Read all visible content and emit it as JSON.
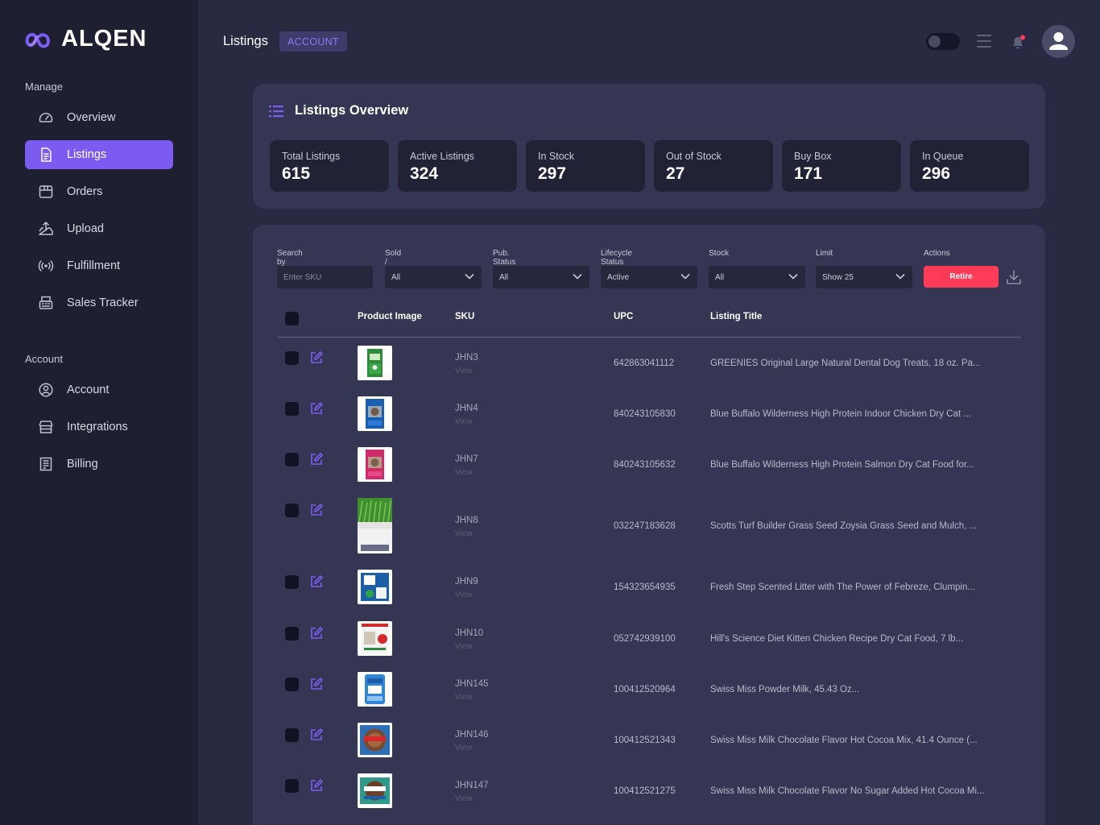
{
  "brand": {
    "name": "ALQEN",
    "logo_icon": "infinity-logo-icon",
    "accent": "#7b5bf0"
  },
  "sidebar": {
    "manage_label": "Manage",
    "manage_items": [
      {
        "label": "Overview",
        "icon": "gauge-icon"
      },
      {
        "label": "Listings",
        "icon": "document-icon",
        "active": true
      },
      {
        "label": "Orders",
        "icon": "box-icon"
      },
      {
        "label": "Upload",
        "icon": "upload-icon"
      },
      {
        "label": "Fulfillment",
        "icon": "broadcast-icon"
      },
      {
        "label": "Sales Tracker",
        "icon": "register-icon"
      }
    ],
    "account_label": "Account",
    "account_items": [
      {
        "label": "Account",
        "icon": "user-circle-icon"
      },
      {
        "label": "Integrations",
        "icon": "store-icon"
      },
      {
        "label": "Billing",
        "icon": "receipt-icon"
      }
    ]
  },
  "header": {
    "title": "Listings",
    "crumb": "ACCOUNT"
  },
  "overview": {
    "title": "Listings Overview",
    "stats": [
      {
        "label": "Total Listings",
        "value": "615"
      },
      {
        "label": "Active Listings",
        "value": "324"
      },
      {
        "label": "In Stock",
        "value": "297"
      },
      {
        "label": "Out of Stock",
        "value": "27"
      },
      {
        "label": "Buy Box",
        "value": "171"
      },
      {
        "label": "In Queue",
        "value": "296"
      }
    ]
  },
  "filters": {
    "search": {
      "label": "Search by SKU",
      "placeholder": "Enter SKU"
    },
    "sold": {
      "label": "Sold / Not Sold",
      "value": "All"
    },
    "pub_status": {
      "label": "Pub. Status",
      "value": "All"
    },
    "lifecycle": {
      "label": "Lifecycle Status",
      "value": "Active"
    },
    "stock": {
      "label": "Stock",
      "value": "All"
    },
    "limit": {
      "label": "Limit",
      "value": "Show 25"
    },
    "actions": {
      "label": "Actions",
      "retire": "Retire"
    }
  },
  "table": {
    "headers": {
      "image": "Product Image",
      "sku": "SKU",
      "upc": "UPC",
      "title": "Listing Title"
    },
    "rows": [
      {
        "sku": "JHN3",
        "view": "View",
        "upc": "642863041112",
        "title": "GREENIES Original Large Natural Dental Dog Treats, 18 oz. Pa..."
      },
      {
        "sku": "JHN4",
        "view": "View",
        "upc": "840243105830",
        "title": "Blue Buffalo Wilderness High Protein Indoor Chicken Dry Cat ..."
      },
      {
        "sku": "JHN7",
        "view": "View",
        "upc": "840243105632",
        "title": "Blue Buffalo Wilderness High Protein Salmon Dry Cat Food for..."
      },
      {
        "sku": "JHN8",
        "view": "View",
        "upc": "032247183628",
        "title": "Scotts Turf Builder Grass Seed Zoysia Grass Seed and Mulch, ..."
      },
      {
        "sku": "JHN9",
        "view": "View",
        "upc": "154323654935",
        "title": "Fresh Step Scented Litter with The Power of Febreze, Clumpin..."
      },
      {
        "sku": "JHN10",
        "view": "View",
        "upc": "052742939100",
        "title": "Hill's Science Diet Kitten Chicken Recipe Dry Cat Food, 7 lb..."
      },
      {
        "sku": "JHN145",
        "view": "View",
        "upc": "100412520964",
        "title": "Swiss Miss Powder Milk, 45.43 Oz..."
      },
      {
        "sku": "JHN146",
        "view": "View",
        "upc": "100412521343",
        "title": "Swiss Miss Milk Chocolate Flavor Hot Cocoa Mix, 41.4 Ounce (..."
      },
      {
        "sku": "JHN147",
        "view": "View",
        "upc": "100412521275",
        "title": "Swiss Miss Milk Chocolate Flavor No Sugar Added Hot Cocoa Mi..."
      }
    ]
  },
  "colors": {
    "danger": "#ff3b57",
    "notification_dot": "#ff3b57"
  }
}
